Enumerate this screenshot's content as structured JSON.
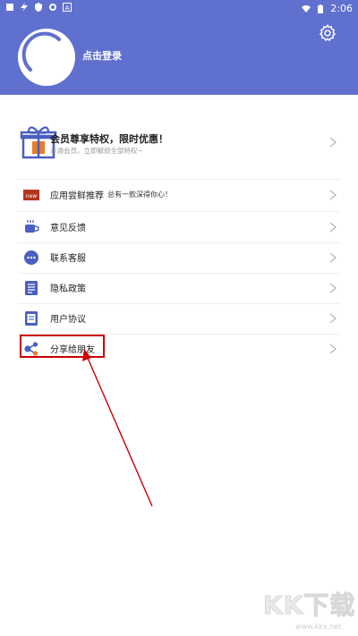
{
  "status_bar": {
    "time": "2:06",
    "left_icons": [
      "notification-icon",
      "bolt-icon",
      "shield-icon",
      "settings-gear-icon",
      "app-a-icon"
    ],
    "right_icons": [
      "wifi-icon",
      "battery-icon"
    ]
  },
  "header": {
    "login_label": "点击登录",
    "settings_icon": "gear-icon"
  },
  "promo": {
    "title": "会员尊享特权，限时优惠！",
    "subtitle": "开通会员，立即解锁全部特权~"
  },
  "menu": [
    {
      "label": "应用尝鲜推荐",
      "sub": "总有一款深得你心！",
      "icon": "new-badge-icon"
    },
    {
      "label": "意见反馈",
      "icon": "coffee-cup-icon"
    },
    {
      "label": "联系客服",
      "icon": "chat-bubble-icon"
    },
    {
      "label": "隐私政策",
      "icon": "document-icon"
    },
    {
      "label": "用户协议",
      "icon": "document-list-icon"
    },
    {
      "label": "分享给朋友",
      "icon": "share-icon"
    }
  ],
  "watermark": {
    "big": "KK下载",
    "small": "www.kkx.net"
  },
  "colors": {
    "header_bg": "#6070CE",
    "annotation_red": "#cc0000",
    "icon_blue": "#4A5FC1",
    "gift_orange": "#E87D2B"
  }
}
